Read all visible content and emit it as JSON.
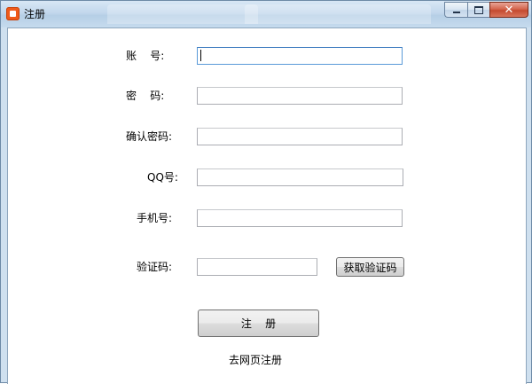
{
  "window": {
    "title": "注册",
    "controls": {
      "minimize": "minimize",
      "maximize": "maximize",
      "close": "✕"
    }
  },
  "form": {
    "account_label": "账    号:",
    "password_label": "密    码:",
    "confirm_label": "确认密码:",
    "qq_label": "QQ号:",
    "phone_label": "手机号:",
    "code_label": "验证码:",
    "account_value": "",
    "password_value": "",
    "confirm_value": "",
    "qq_value": "",
    "phone_value": "",
    "code_value": ""
  },
  "buttons": {
    "get_code": "获取验证码",
    "register": "注    册"
  },
  "links": {
    "web_register": "去网页注册"
  },
  "icons": {
    "app": "app-icon",
    "minimize": "minimize-icon",
    "maximize": "maximize-icon",
    "close": "close-icon"
  },
  "colors": {
    "title_bar": "#c2d7ec",
    "close_button": "#c44a2f",
    "focus_border": "#5a9ad8"
  }
}
